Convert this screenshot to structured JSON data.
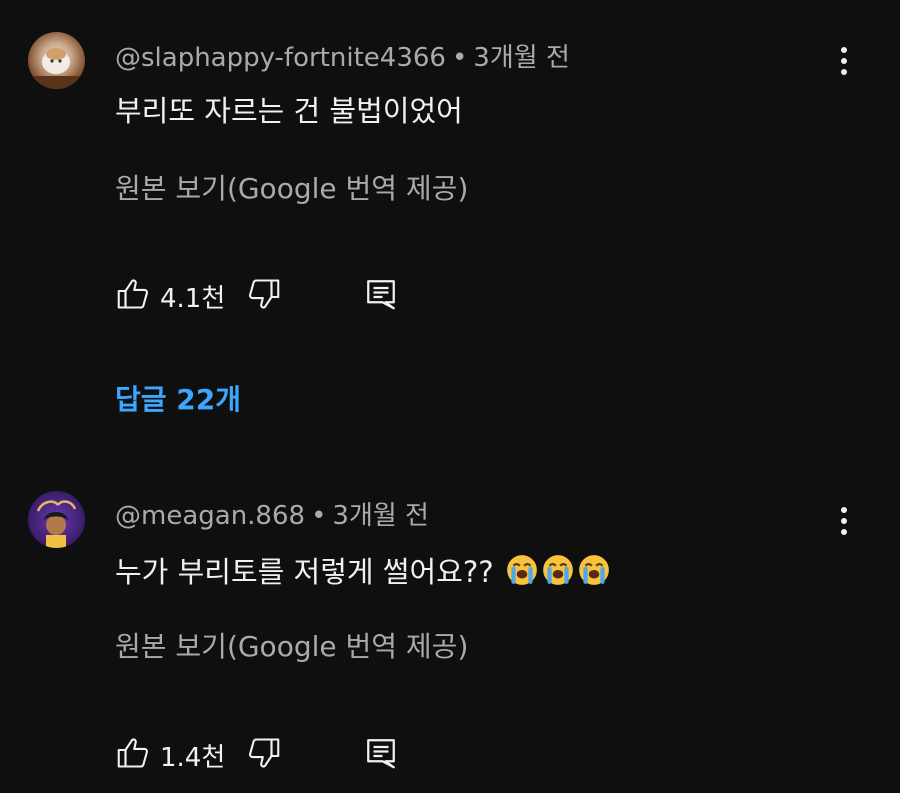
{
  "comments": [
    {
      "author": "@slaphappy-fortnite4366",
      "time": "3개월 전",
      "text": "부리또 자르는 건 불법이었어",
      "translate_link": "원본 보기(Google 번역 제공)",
      "likes": "4.1천",
      "replies_label": "답글 22개"
    },
    {
      "author": "@meagan.868",
      "time": "3개월 전",
      "text": "누가 부리토를 저렇게 썰어요??",
      "emojis": [
        "loudly-crying-face",
        "loudly-crying-face",
        "loudly-crying-face"
      ],
      "translate_link": "원본 보기(Google 번역 제공)",
      "likes": "1.4천"
    }
  ],
  "separator": "•",
  "colors": {
    "background": "#0f0f0f",
    "primary_text": "#f1f1f1",
    "secondary_text": "#aaaaaa",
    "link": "#3ea6ff"
  }
}
